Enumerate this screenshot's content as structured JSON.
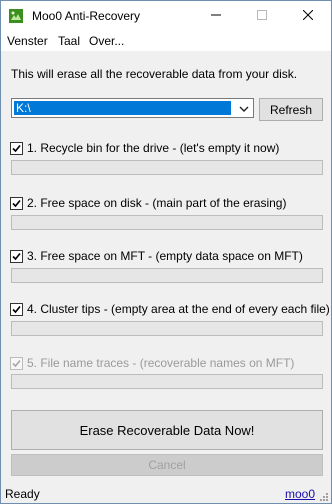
{
  "window": {
    "title": "Moo0 Anti-Recovery",
    "controls": {
      "minimize": "minimize-icon",
      "maximize": "maximize-icon",
      "close": "close-icon"
    }
  },
  "menu": {
    "items": [
      "Venster",
      "Taal",
      "Over..."
    ]
  },
  "intro": "This will erase all the recoverable data from your disk.",
  "drive": {
    "selected": "K:\\"
  },
  "refresh_label": "Refresh",
  "options": [
    {
      "label": "1. Recycle bin for the drive - (let's empty it now)",
      "checked": true,
      "enabled": true,
      "progress": 0
    },
    {
      "label": "2. Free space on disk - (main part of the erasing)",
      "checked": true,
      "enabled": true,
      "progress": 0
    },
    {
      "label": "3. Free space on MFT - (empty data space on MFT)",
      "checked": true,
      "enabled": true,
      "progress": 0
    },
    {
      "label": "4. Cluster tips - (empty area at the end of every each file)",
      "checked": true,
      "enabled": true,
      "progress": 0
    },
    {
      "label": "5. File name traces - (recoverable names on MFT)",
      "checked": true,
      "enabled": false,
      "progress": 0
    }
  ],
  "erase_label": "Erase Recoverable Data Now!",
  "cancel_label": "Cancel",
  "status": {
    "text": "Ready",
    "link": "moo0"
  },
  "colors": {
    "selection": "#0078d7",
    "link": "#1a0dab",
    "window_border": "#6e8fb0"
  }
}
